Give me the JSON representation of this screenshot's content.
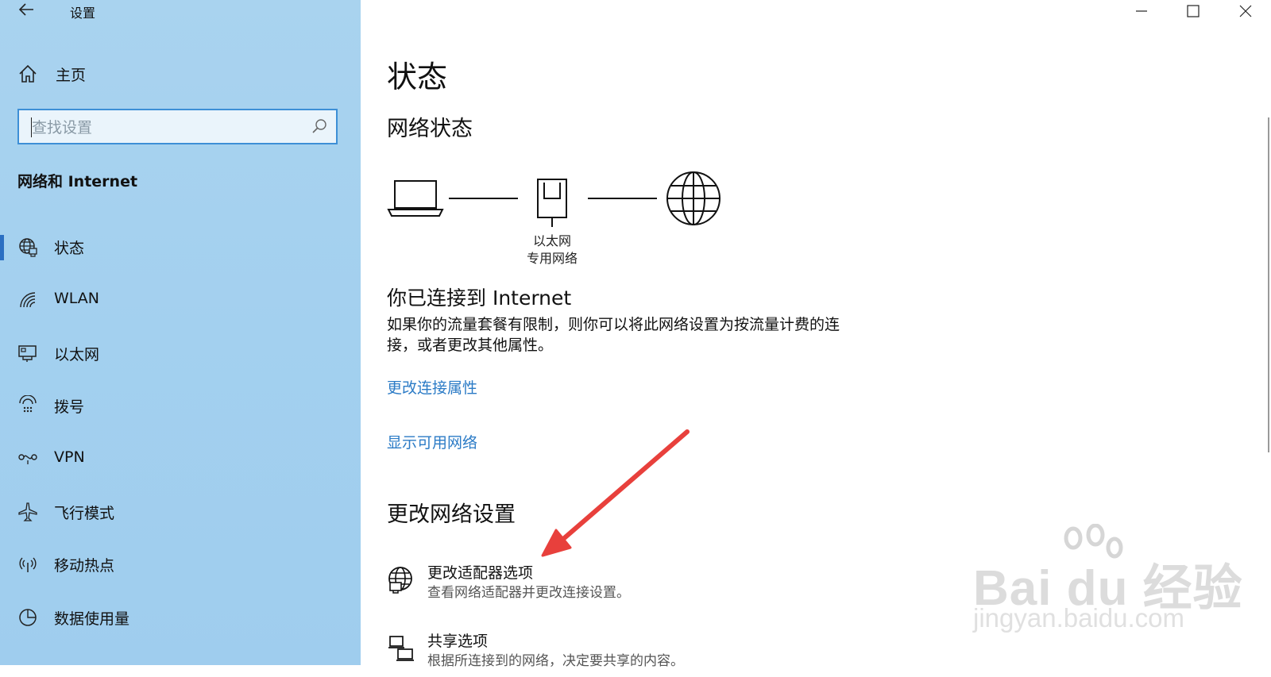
{
  "window": {
    "title": "设置"
  },
  "sidebar": {
    "home_label": "主页",
    "search_placeholder": "查找设置",
    "section_title": "网络和 Internet",
    "items": [
      {
        "label": "状态",
        "icon": "globe-status-icon",
        "selected": true
      },
      {
        "label": "WLAN",
        "icon": "wifi-icon",
        "selected": false
      },
      {
        "label": "以太网",
        "icon": "ethernet-icon",
        "selected": false
      },
      {
        "label": "拨号",
        "icon": "dialup-icon",
        "selected": false
      },
      {
        "label": "VPN",
        "icon": "vpn-icon",
        "selected": false
      },
      {
        "label": "飞行模式",
        "icon": "airplane-icon",
        "selected": false
      },
      {
        "label": "移动热点",
        "icon": "hotspot-icon",
        "selected": false
      },
      {
        "label": "数据使用量",
        "icon": "data-usage-icon",
        "selected": false
      }
    ]
  },
  "main": {
    "page_title": "状态",
    "network_status_heading": "网络状态",
    "diagram": {
      "adapter_name": "以太网",
      "network_type": "专用网络"
    },
    "connected_title": "你已连接到 Internet",
    "connected_desc": "如果你的流量套餐有限制，则你可以将此网络设置为按流量计费的连接，或者更改其他属性。",
    "link_change_properties": "更改连接属性",
    "link_show_networks": "显示可用网络",
    "change_settings_heading": "更改网络设置",
    "options": [
      {
        "title": "更改适配器选项",
        "subtitle": "查看网络适配器并更改连接设置。",
        "icon": "adapter-globe-icon"
      },
      {
        "title": "共享选项",
        "subtitle": "根据所连接到的网络，决定要共享的内容。",
        "icon": "sharing-icon"
      }
    ]
  },
  "watermark": {
    "brand": "Bai du 经验",
    "url": "jingyan.baidu.com"
  },
  "colors": {
    "sidebar_bg": "#a3d0ef",
    "accent": "#2b6fc2",
    "link": "#2b7bc6",
    "annotation_arrow": "#e8403c"
  }
}
